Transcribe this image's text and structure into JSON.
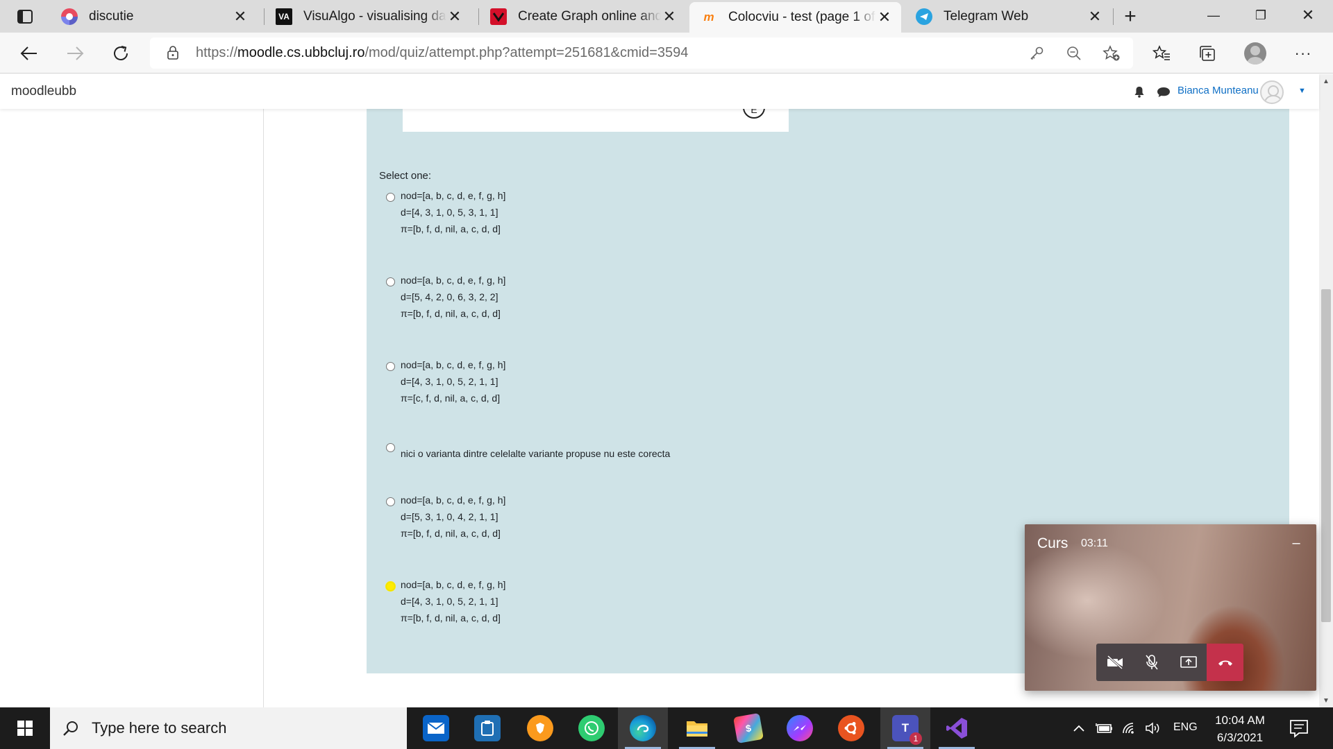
{
  "browser": {
    "tabs": [
      {
        "title": "discutie"
      },
      {
        "title": "VisuAlgo - visualising data structures and algorithms"
      },
      {
        "title": "Create Graph online and find shortest path"
      },
      {
        "title": "Colocviu - test (page 1 of"
      },
      {
        "title": "Telegram Web"
      }
    ],
    "url_scheme": "https://",
    "url_host": "moodle.cs.ubbcluj.ro",
    "url_path": "/mod/quiz/attempt.php?attempt=251681&cmid=3594"
  },
  "moodle": {
    "brand": "moodleubb",
    "user_name": "Bianca Munteanu"
  },
  "quiz": {
    "graph_node_label": "E",
    "prompt": "Select one:",
    "options": [
      {
        "nod": "nod=[a, b, c, d, e, f, g, h]",
        "d": "d=[4, 3, 1, 0, 5, 3, 1, 1]",
        "pi": "π=[b, f, d, nil, a, c, d, d]"
      },
      {
        "nod": "nod=[a, b, c, d, e, f, g, h]",
        "d": "d=[5, 4, 2, 0, 6, 3, 2, 2]",
        "pi": "π=[b, f, d, nil, a, c, d, d]"
      },
      {
        "nod": "nod=[a, b, c, d, e, f, g, h]",
        "d": "d=[4, 3, 1, 0, 5, 2, 1, 1]",
        "pi": "π=[c, f, d, nil, a, c, d, d]"
      },
      {
        "text": "nici o varianta dintre celelalte variante propuse nu este corecta"
      },
      {
        "nod": "nod=[a, b, c, d, e, f, g, h]",
        "d": "d=[5, 3, 1, 0, 4, 2, 1, 1]",
        "pi": "π=[b, f, d, nil, a, c, d, d]"
      },
      {
        "nod": "nod=[a, b, c, d, e, f, g, h]",
        "d": "d=[4, 3, 1, 0, 5, 2, 1, 1]",
        "pi": "π=[b, f, d, nil, a, c, d, d]"
      }
    ]
  },
  "call": {
    "title": "Curs",
    "duration": "03:11"
  },
  "taskbar": {
    "search_placeholder": "Type here to search",
    "language": "ENG",
    "time": "10:04 AM",
    "date": "6/3/2021",
    "teams_badge": "1"
  },
  "colors": {
    "question_bg": "#cfe3e7",
    "link_blue": "#0f6fc5",
    "highlight_yellow": "#ffeb00",
    "hangup_red": "#c4314b"
  }
}
